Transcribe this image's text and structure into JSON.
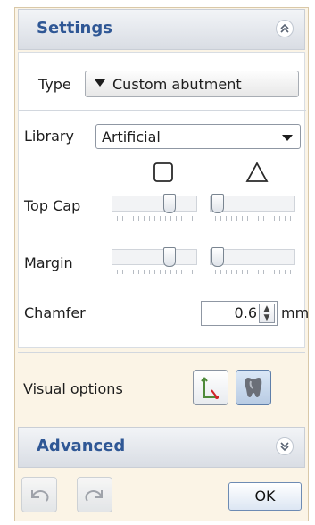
{
  "settings": {
    "title": "Settings",
    "collapse_icon": "chevron-up-double-icon",
    "type_label": "Type",
    "type_value": "Custom abutment",
    "library_label": "Library",
    "library_value": "Artificial",
    "shape_square_icon": "square-icon",
    "shape_triangle_icon": "triangle-icon",
    "top_cap_label": "Top Cap",
    "top_cap_square_level": 0.7,
    "top_cap_triangle_level": 0.05,
    "margin_label": "Margin",
    "margin_square_level": 0.7,
    "margin_triangle_level": 0.05,
    "chamfer_label": "Chamfer",
    "chamfer_value": "0.6",
    "chamfer_unit": "mm",
    "visual_options_label": "Visual options",
    "visual_option_1_icon": "axis-measure-icon",
    "visual_option_2_icon": "tooth-shade-icon",
    "visual_option_2_active": true
  },
  "advanced": {
    "title": "Advanced",
    "expand_icon": "chevron-down-double-icon"
  },
  "footer": {
    "undo_icon": "undo-icon",
    "redo_icon": "redo-icon",
    "ok_label": "OK"
  },
  "colors": {
    "title_blue": "#2f5795",
    "panel_bg": "#fbf4e6",
    "header_bg": "#e3e7ed",
    "accent_red": "#d2232a"
  }
}
